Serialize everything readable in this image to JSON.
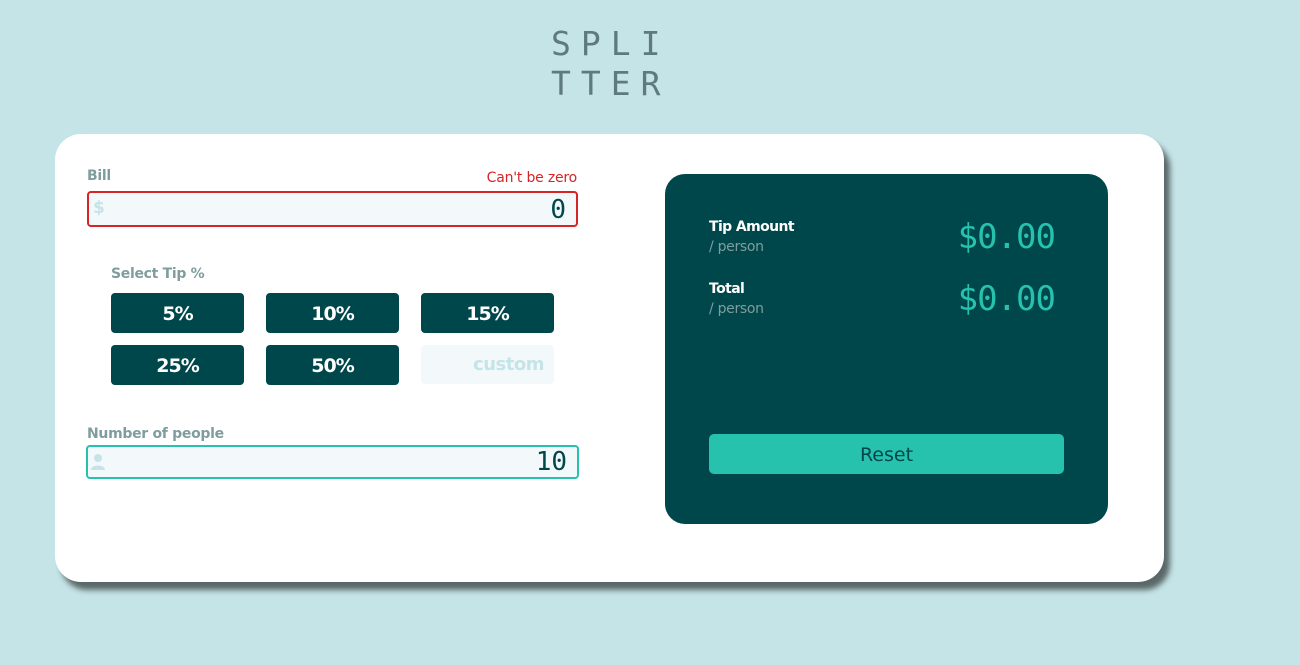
{
  "app": {
    "logo_line1": "SPLI",
    "logo_line2": "TTER"
  },
  "bill": {
    "label": "Bill",
    "error": "Can't be zero",
    "icon": "dollar-icon",
    "currency_symbol": "$",
    "value": "0"
  },
  "tip": {
    "label": "Select Tip %",
    "options": [
      "5%",
      "10%",
      "15%",
      "25%",
      "50%"
    ],
    "custom_placeholder": "custom"
  },
  "people": {
    "label": "Number of people",
    "icon": "person-icon",
    "value": "10"
  },
  "results": {
    "tip_amount": {
      "title": "Tip Amount",
      "sub": "/ person",
      "value": "$0.00"
    },
    "total": {
      "title": "Total",
      "sub": "/ person",
      "value": "$0.00"
    },
    "reset_label": "Reset"
  },
  "colors": {
    "background": "#c5e4e7",
    "dark_cyan": "#00474b",
    "accent": "#26c2ad",
    "error": "#d72424",
    "grayish": "#7f9d9f"
  }
}
